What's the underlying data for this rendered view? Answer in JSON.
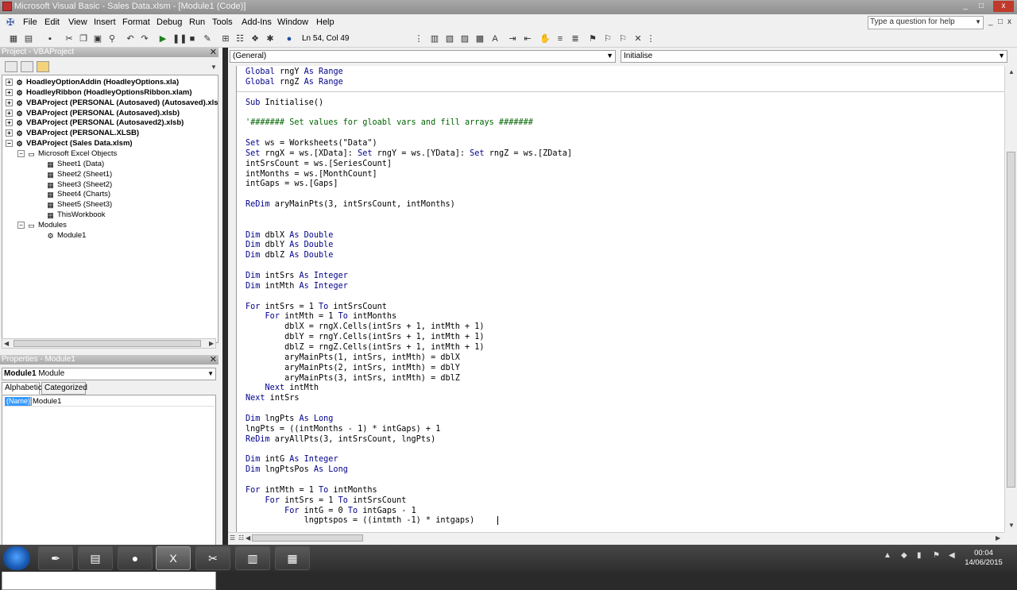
{
  "window": {
    "title": "Microsoft Visual Basic - Sales Data.xlsm - [Module1 (Code)]",
    "controls": [
      "_",
      "□",
      "x"
    ]
  },
  "menu": {
    "items": [
      "File",
      "Edit",
      "View",
      "Insert",
      "Format",
      "Debug",
      "Run",
      "Tools",
      "Add-Ins",
      "Window",
      "Help"
    ],
    "help_placeholder": "Type a question for help",
    "mdi_controls": [
      "_",
      "□",
      "x"
    ]
  },
  "toolbar": {
    "position": "Ln 54, Col 49"
  },
  "project_pane": {
    "title": "Project - VBAProject",
    "tree": [
      {
        "label": "HoadleyOptionAddin (HoadleyOptions.xla)",
        "level": 0,
        "bold": true,
        "icon": "vbaproject-icon"
      },
      {
        "label": "HoadleyRibbon (HoadleyOptionsRibbon.xlam)",
        "level": 0,
        "bold": true,
        "icon": "vbaproject-icon"
      },
      {
        "label": "VBAProject (PERSONAL (Autosaved) (Autosaved).xlsb)",
        "level": 0,
        "bold": true,
        "icon": "vbaproject-icon"
      },
      {
        "label": "VBAProject (PERSONAL (Autosaved).xlsb)",
        "level": 0,
        "bold": true,
        "icon": "vbaproject-icon"
      },
      {
        "label": "VBAProject (PERSONAL (Autosaved2).xlsb)",
        "level": 0,
        "bold": true,
        "icon": "vbaproject-icon"
      },
      {
        "label": "VBAProject (PERSONAL.XLSB)",
        "level": 0,
        "bold": true,
        "icon": "vbaproject-icon"
      },
      {
        "label": "VBAProject (Sales Data.xlsm)",
        "level": 0,
        "bold": true,
        "icon": "vbaproject-icon"
      },
      {
        "label": "Microsoft Excel Objects",
        "level": 1,
        "bold": false,
        "icon": "folder-icon"
      },
      {
        "label": "Sheet1 (Data)",
        "level": 2,
        "bold": false,
        "icon": "sheet-icon"
      },
      {
        "label": "Sheet2 (Sheet1)",
        "level": 2,
        "bold": false,
        "icon": "sheet-icon"
      },
      {
        "label": "Sheet3 (Sheet2)",
        "level": 2,
        "bold": false,
        "icon": "sheet-icon"
      },
      {
        "label": "Sheet4 (Charts)",
        "level": 2,
        "bold": false,
        "icon": "sheet-icon"
      },
      {
        "label": "Sheet5 (Sheet3)",
        "level": 2,
        "bold": false,
        "icon": "sheet-icon"
      },
      {
        "label": "ThisWorkbook",
        "level": 2,
        "bold": false,
        "icon": "workbook-icon"
      },
      {
        "label": "Modules",
        "level": 1,
        "bold": false,
        "icon": "folder-icon"
      },
      {
        "label": "Module1",
        "level": 2,
        "bold": false,
        "icon": "module-icon"
      }
    ]
  },
  "properties_pane": {
    "title": "Properties - Module1",
    "object": "Module1",
    "object_type": "Module",
    "tabs": [
      "Alphabetic",
      "Categorized"
    ],
    "rows": [
      {
        "key": "(Name)",
        "value": "Module1"
      }
    ]
  },
  "code_window": {
    "object_combo": "(General)",
    "proc_combo": "Initialise",
    "lines": [
      "Global rngY As Range",
      "Global rngZ As Range",
      "",
      "Sub Initialise()",
      "",
      "'####### Set values for gloabl vars and fill arrays #######",
      "",
      "Set ws = Worksheets(\"Data\")",
      "Set rngX = ws.[XData]: Set rngY = ws.[YData]: Set rngZ = ws.[ZData]",
      "intSrsCount = ws.[SeriesCount]",
      "intMonths = ws.[MonthCount]",
      "intGaps = ws.[Gaps]",
      "",
      "ReDim aryMainPts(3, intSrsCount, intMonths)",
      "",
      "",
      "Dim dblX As Double",
      "Dim dblY As Double",
      "Dim dblZ As Double",
      "",
      "Dim intSrs As Integer",
      "Dim intMth As Integer",
      "",
      "For intSrs = 1 To intSrsCount",
      "    For intMth = 1 To intMonths",
      "        dblX = rngX.Cells(intSrs + 1, intMth + 1)",
      "        dblY = rngY.Cells(intSrs + 1, intMth + 1)",
      "        dblZ = rngZ.Cells(intSrs + 1, intMth + 1)",
      "        aryMainPts(1, intSrs, intMth) = dblX",
      "        aryMainPts(2, intSrs, intMth) = dblY",
      "        aryMainPts(3, intSrs, intMth) = dblZ",
      "    Next intMth",
      "Next intSrs",
      "",
      "Dim lngPts As Long",
      "lngPts = ((intMonths - 1) * intGaps) + 1",
      "ReDim aryAllPts(3, intSrsCount, lngPts)",
      "",
      "Dim intG As Integer",
      "Dim lngPtsPos As Long",
      "",
      "For intMth = 1 To intMonths",
      "    For intSrs = 1 To intSrsCount",
      "        For intG = 0 To intGaps - 1",
      "            lngptspos = ((intmth -1) * intgaps) "
    ]
  },
  "taskbar": {
    "time": "00:04",
    "date": "14/06/2015"
  }
}
